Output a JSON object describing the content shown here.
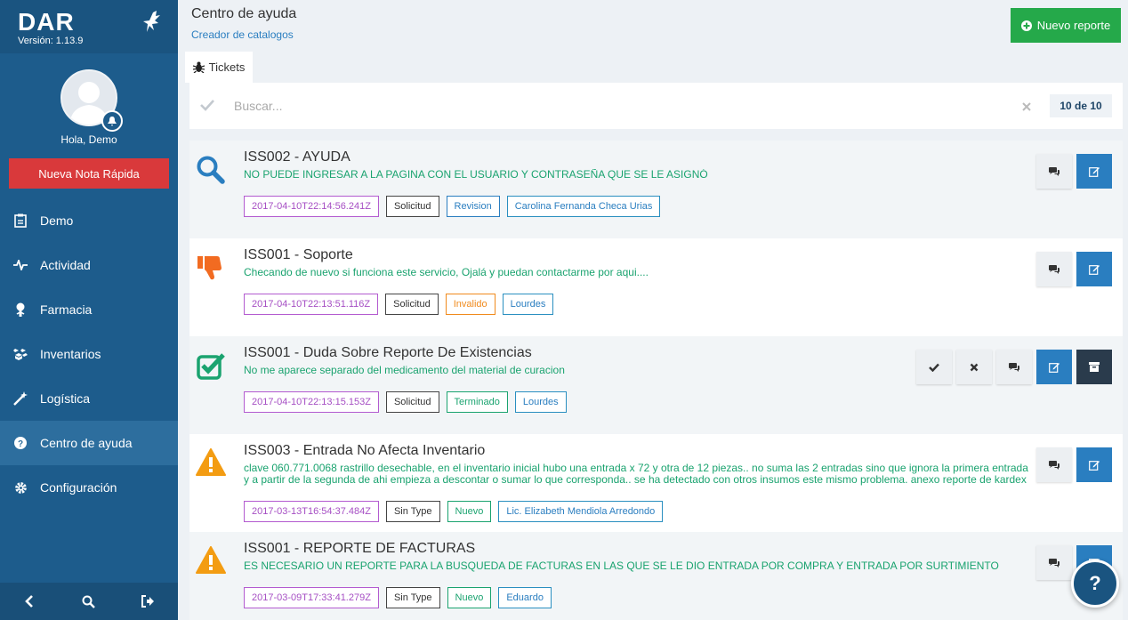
{
  "sidebar": {
    "brand": "DAR",
    "version": "Versión: 1.13.9",
    "greeting": "Hola, Demo",
    "quick_note": "Nueva Nota Rápida",
    "items": [
      {
        "label": "Demo",
        "icon": "clipboard-icon"
      },
      {
        "label": "Actividad",
        "icon": "heartbeat-icon"
      },
      {
        "label": "Farmacia",
        "icon": "pill-icon"
      },
      {
        "label": "Inventarios",
        "icon": "cubes-icon"
      },
      {
        "label": "Logística",
        "icon": "magic-wand-icon"
      },
      {
        "label": "Centro de ayuda",
        "icon": "question-circle-icon",
        "active": true
      },
      {
        "label": "Configuración",
        "icon": "gear-icon"
      }
    ]
  },
  "header": {
    "title": "Centro de ayuda",
    "subtitle": "Creador de catalogos",
    "new_report": "Nuevo reporte"
  },
  "tabs": [
    {
      "label": "Tickets",
      "icon": "bug-icon"
    }
  ],
  "search": {
    "placeholder": "Buscar...",
    "count": "10 de 10"
  },
  "tickets": [
    {
      "title": "ISS002 - AYUDA",
      "description": "NO PUEDE INGRESAR A LA PAGINA CON EL USUARIO Y CONTRASEÑA QUE SE LE ASIGNÓ",
      "icon": "search-icon",
      "date": "2017-04-10T22:14:56.241Z",
      "type": "Solicitud",
      "status": "Revision",
      "user": "Carolina Fernanda Checa Urias"
    },
    {
      "title": "ISS001 - Soporte",
      "description": "Checando de nuevo si funciona este servicio, Ojalá y puedan contactarme por aqui....",
      "icon": "thumbs-down-icon",
      "date": "2017-04-10T22:13:51.116Z",
      "type": "Solicitud",
      "status": "Invalido",
      "user": "Lourdes"
    },
    {
      "title": "ISS001 - Duda Sobre Reporte De Existencias",
      "description": "No me aparece separado del medicamento del material de curacion",
      "icon": "check-square-icon",
      "date": "2017-04-10T22:13:15.153Z",
      "type": "Solicitud",
      "status": "Terminado",
      "user": "Lourdes"
    },
    {
      "title": "ISS003 - Entrada No Afecta Inventario",
      "description": "clave 060.771.0068 rastrillo desechable, en el inventario inicial hubo una entrada x 72 y otra de 12 piezas.. no suma las 2 entradas sino que ignora la primera entrada y a partir de la segunda de ahi empieza a descontar o sumar lo que corresponda.. se ha detectado con otros insumos este mismo problema. anexo reporte de kardex",
      "icon": "warning-icon",
      "date": "2017-03-13T16:54:37.484Z",
      "type": "Sin Type",
      "status": "Nuevo",
      "user": "Lic. Elizabeth Mendiola Arredondo"
    },
    {
      "title": "ISS001 - REPORTE DE FACTURAS",
      "description": "ES NECESARIO UN REPORTE PARA LA BUSQUEDA DE FACTURAS EN LAS QUE SE LE DIO ENTRADA POR COMPRA Y ENTRADA POR SURTIMIENTO",
      "icon": "warning-icon",
      "date": "2017-03-09T17:33:41.279Z",
      "type": "Sin Type",
      "status": "Nuevo",
      "user": "Eduardo"
    }
  ],
  "help_fab": "?",
  "colors": {
    "sidebar": "#1d5c8c",
    "accent_blue": "#2a7ec0",
    "success": "#25a94a",
    "danger": "#d9393b",
    "warning": "#f39c12",
    "thumbs": "#f26b21",
    "status_green": "#1aa36f"
  }
}
